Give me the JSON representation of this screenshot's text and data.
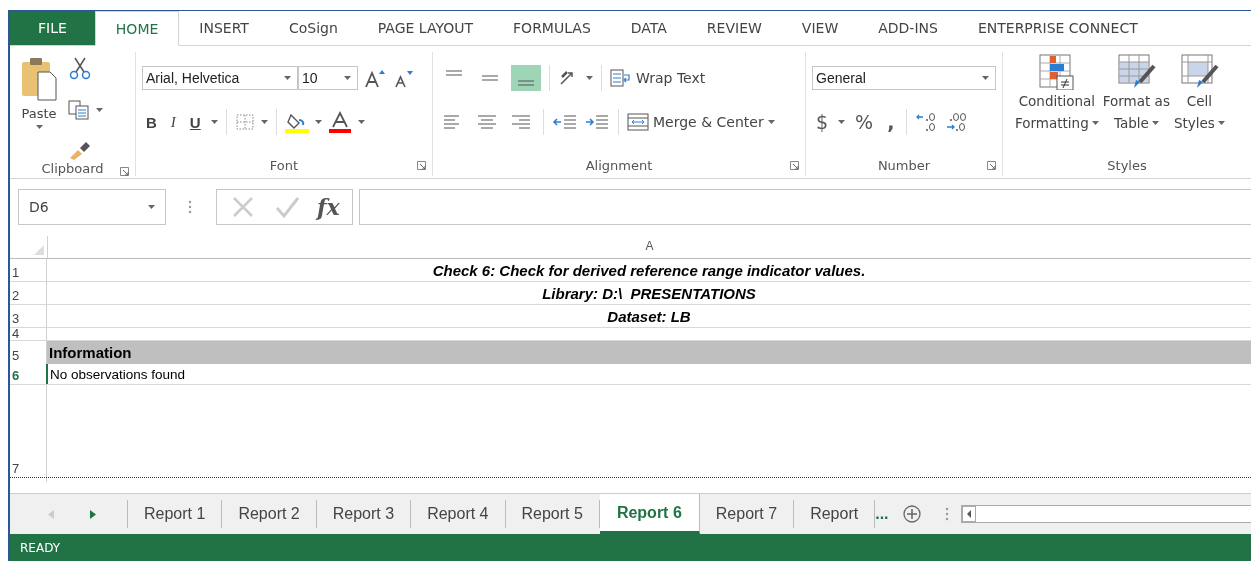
{
  "ribbon_tabs": [
    {
      "label": "FILE",
      "kind": "file",
      "selected": false
    },
    {
      "label": "HOME",
      "kind": "tab",
      "selected": true
    },
    {
      "label": "INSERT",
      "kind": "tab",
      "selected": false
    },
    {
      "label": "CoSign",
      "kind": "tab",
      "selected": false
    },
    {
      "label": "PAGE LAYOUT",
      "kind": "tab",
      "selected": false
    },
    {
      "label": "FORMULAS",
      "kind": "tab",
      "selected": false
    },
    {
      "label": "DATA",
      "kind": "tab",
      "selected": false
    },
    {
      "label": "REVIEW",
      "kind": "tab",
      "selected": false
    },
    {
      "label": "VIEW",
      "kind": "tab",
      "selected": false
    },
    {
      "label": "ADD-INS",
      "kind": "tab",
      "selected": false
    },
    {
      "label": "ENTERPRISE CONNECT",
      "kind": "tab",
      "selected": false
    }
  ],
  "clipboard": {
    "paste": "Paste",
    "label": "Clipboard"
  },
  "font": {
    "name": "Arial, Helvetica",
    "size": "10",
    "bold": "B",
    "italic": "I",
    "underline": "U",
    "label": "Font"
  },
  "alignment": {
    "vertical": [
      {
        "kind": "top",
        "selected": false
      },
      {
        "kind": "middle",
        "selected": false
      },
      {
        "kind": "bottom",
        "selected": true
      }
    ],
    "wrap_text": "Wrap Text",
    "merge": "Merge & Center",
    "label": "Alignment"
  },
  "number": {
    "format": "General",
    "currency": "$",
    "percent": "%",
    "comma": ",",
    "label": "Number"
  },
  "styles": {
    "buttons": [
      {
        "kind": "conditional",
        "lines": [
          "Conditional",
          "Formatting"
        ]
      },
      {
        "kind": "table",
        "lines": [
          "Format as",
          "Table"
        ]
      },
      {
        "kind": "cell",
        "lines": [
          "Cell",
          "Styles"
        ]
      }
    ],
    "label": "Styles"
  },
  "formula_bar": {
    "name_box": "D6",
    "fx": "fx"
  },
  "sheet": {
    "column": "A",
    "rows": [
      {
        "number": "1",
        "kind": "title",
        "text": "Check 6: Check for derived reference range indicator values.",
        "selected": false
      },
      {
        "number": "2",
        "kind": "title",
        "text": "Library: D:\\  PRESENTATIONS",
        "selected": false
      },
      {
        "number": "3",
        "kind": "title",
        "text": "Dataset: LB",
        "selected": false
      },
      {
        "number": "4",
        "kind": "short",
        "text": "",
        "selected": false
      },
      {
        "number": "5",
        "kind": "header",
        "text": "Information",
        "selected": false
      },
      {
        "number": "6",
        "kind": "plain",
        "text": "No observations found",
        "selected": true
      },
      {
        "number": "7",
        "kind": "tall",
        "text": "",
        "selected": false
      }
    ]
  },
  "sheet_tabs": [
    {
      "label": "Report 1",
      "selected": false
    },
    {
      "label": "Report 2",
      "selected": false
    },
    {
      "label": "Report 3",
      "selected": false
    },
    {
      "label": "Report 4",
      "selected": false
    },
    {
      "label": "Report 5",
      "selected": false
    },
    {
      "label": "Report 6",
      "selected": true
    },
    {
      "label": "Report 7",
      "selected": false
    },
    {
      "label": "Report",
      "selected": false
    }
  ],
  "more_tabs": "...",
  "status_bar": "READY"
}
